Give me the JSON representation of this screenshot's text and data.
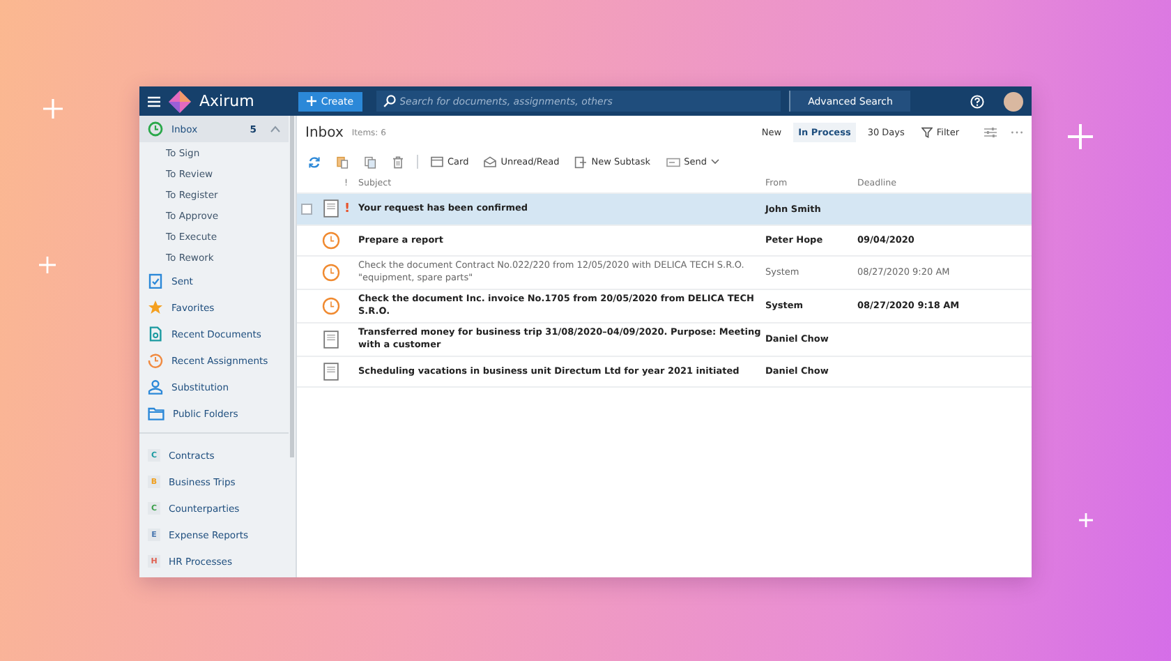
{
  "header": {
    "brand": "Axirum",
    "create_button": "Create",
    "search": {
      "placeholder": "Search for documents, assignments, others"
    },
    "advanced_search": "Advanced Search"
  },
  "sidebar": {
    "items": [
      {
        "kind": "main",
        "label": "Inbox",
        "count": "5",
        "expanded": true,
        "selected": true,
        "children": [
          {
            "label": "To Sign",
            "selected": false
          },
          {
            "label": "To Review",
            "selected": false
          },
          {
            "label": "To Register",
            "selected": false
          },
          {
            "label": "To Approve",
            "selected": false
          },
          {
            "label": "To Execute",
            "selected": false
          },
          {
            "label": "To Rework",
            "selected": false
          }
        ]
      },
      {
        "kind": "main",
        "label": "Sent",
        "selected": false
      },
      {
        "kind": "main",
        "label": "Favorites",
        "selected": false
      },
      {
        "kind": "main",
        "label": "Recent Documents",
        "selected": false
      },
      {
        "kind": "main",
        "label": "Recent Assignments",
        "selected": false
      },
      {
        "kind": "main",
        "label": "Substitution",
        "selected": false
      },
      {
        "kind": "main",
        "label": "Public Folders",
        "selected": false
      },
      {
        "kind": "module",
        "letter": "C",
        "color": "#1a9aa0",
        "label": "Contracts",
        "selected": false
      },
      {
        "kind": "module",
        "letter": "B",
        "color": "#f0a020",
        "label": "Business Trips",
        "selected": false
      },
      {
        "kind": "module",
        "letter": "C",
        "color": "#3aa04a",
        "label": "Counterparties",
        "selected": false
      },
      {
        "kind": "module",
        "letter": "E",
        "color": "#4a78b0",
        "label": "Expense Reports",
        "selected": false
      },
      {
        "kind": "module",
        "letter": "H",
        "color": "#e06050",
        "label": "HR Processes",
        "selected": false
      }
    ]
  },
  "inbox": {
    "title": "Inbox",
    "items_count": "Items: 6",
    "filters": [
      {
        "label": "New",
        "selected": false
      },
      {
        "label": "In Process",
        "selected": true
      },
      {
        "label": "30 Days",
        "selected": false
      }
    ],
    "filter_button": "Filter",
    "toolbar": [
      {
        "label": "Card",
        "dropdown": false
      },
      {
        "label": "Unread/Read",
        "dropdown": false
      },
      {
        "label": "New Subtask",
        "dropdown": false
      },
      {
        "label": "Send",
        "dropdown": true
      }
    ],
    "columns": [
      "!",
      "Subject",
      "From",
      "Deadline"
    ],
    "rows": [
      {
        "kind": "document",
        "flag": "!",
        "subject": "Your request has been confirmed",
        "from": "John Smith",
        "unread": true,
        "selected": true
      },
      {
        "kind": "task",
        "subject": "Prepare a report",
        "from": "Peter Hope",
        "deadline": "09/04/2020",
        "unread": true,
        "selected": false
      },
      {
        "kind": "task",
        "subject": "Check the document Contract No.022/220 from 12/05/2020 with DELICA TECH S.R.O. \"equipment, spare parts\"",
        "from": "System",
        "deadline": "08/27/2020 9:20 AM",
        "unread": false,
        "selected": false
      },
      {
        "kind": "task",
        "subject": "Check the document Inc. invoice No.1705 from 20/05/2020 from DELICA TECH S.R.O.",
        "from": "System",
        "deadline": "08/27/2020 9:18 AM",
        "unread": true,
        "selected": false
      },
      {
        "kind": "document",
        "subject": "Transferred money for business trip 31/08/2020–04/09/2020. Purpose: Meeting with a customer",
        "from": "Daniel Chow",
        "unread": true,
        "selected": false
      },
      {
        "kind": "document",
        "subject": "Scheduling vacations in business unit Directum Ltd for year 2021 initiated",
        "from": "Daniel Chow",
        "unread": true,
        "selected": false
      }
    ]
  }
}
